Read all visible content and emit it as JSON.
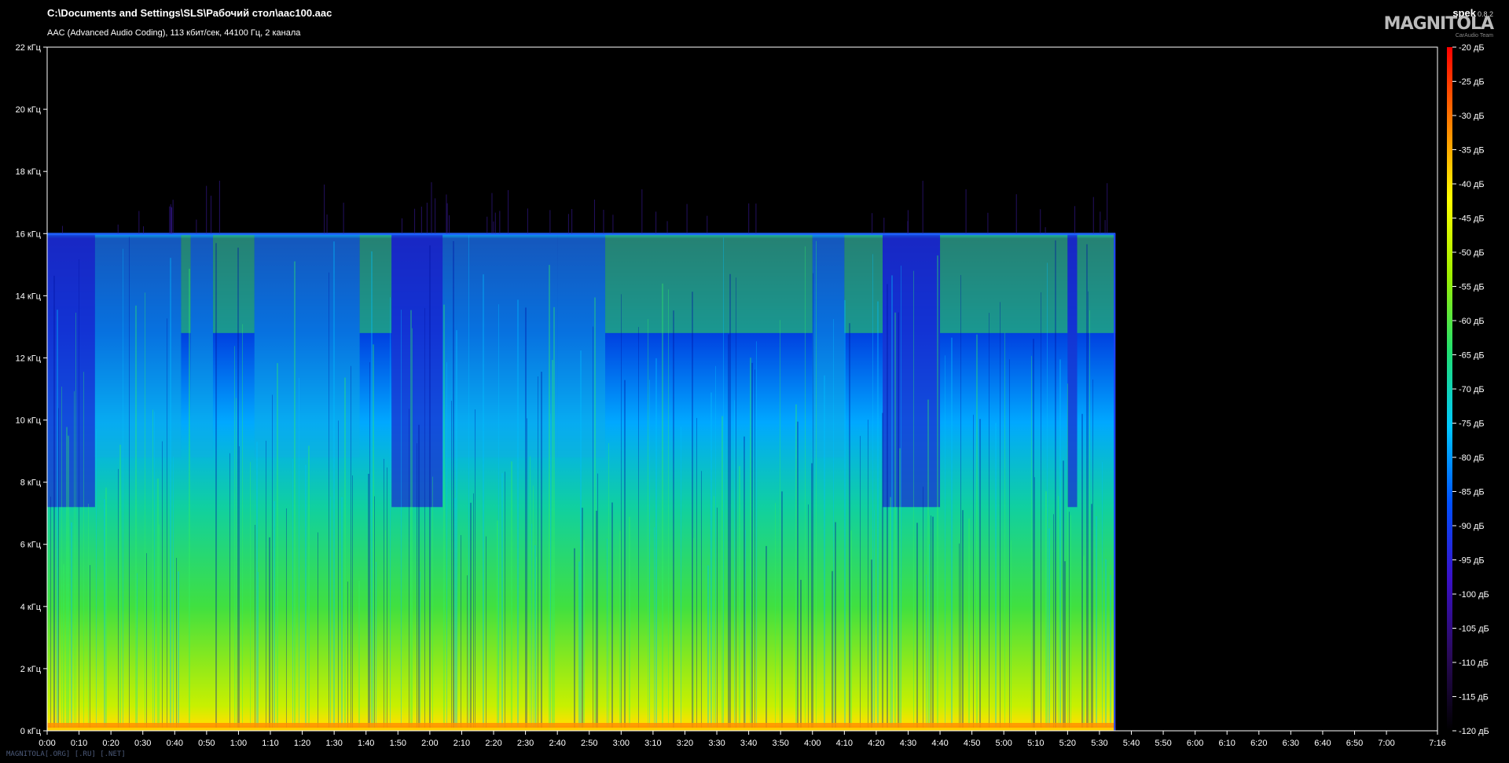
{
  "header": {
    "file_title": "C:\\Documents and Settings\\SLS\\Рабочий стол\\aac100.aac",
    "file_info": "AAC (Advanced Audio Coding), 113 кбит/сек, 44100 Гц, 2 канала",
    "app_name": "spek",
    "app_version": "0.8.2",
    "logo_text": "MAGNITOLA",
    "logo_subtext": "CarAudio Team"
  },
  "watermark": "MAGNITOLA[.ORG] [.RU] [.NET]",
  "chart_data": {
    "type": "heatmap",
    "title": "",
    "xlabel": "",
    "ylabel": "",
    "x_unit": "time (m:ss)",
    "y_unit": "kHz",
    "xlim_seconds": [
      0,
      436
    ],
    "ylim_khz": [
      0,
      22
    ],
    "audio_end_seconds": 335,
    "lowpass_cutoff_khz": 16,
    "x_ticks": [
      "0:00",
      "0:10",
      "0:20",
      "0:30",
      "0:40",
      "0:50",
      "1:00",
      "1:10",
      "1:20",
      "1:30",
      "1:40",
      "1:50",
      "2:00",
      "2:10",
      "2:20",
      "2:30",
      "2:40",
      "2:50",
      "3:00",
      "3:10",
      "3:20",
      "3:30",
      "3:40",
      "3:50",
      "4:00",
      "4:10",
      "4:20",
      "4:30",
      "4:40",
      "4:50",
      "5:00",
      "5:10",
      "5:20",
      "5:30",
      "5:40",
      "5:50",
      "6:00",
      "6:10",
      "6:20",
      "6:30",
      "6:40",
      "6:50",
      "7:00",
      "7:16"
    ],
    "y_ticks": [
      "0 кГц",
      "2 кГц",
      "4 кГц",
      "6 кГц",
      "8 кГц",
      "10 кГц",
      "12 кГц",
      "14 кГц",
      "16 кГц",
      "18 кГц",
      "20 кГц",
      "22 кГц"
    ],
    "colorbar_ticks": [
      "-20 дБ",
      "-25 дБ",
      "-30 дБ",
      "-35 дБ",
      "-40 дБ",
      "-45 дБ",
      "-50 дБ",
      "-55 дБ",
      "-60 дБ",
      "-65 дБ",
      "-70 дБ",
      "-75 дБ",
      "-80 дБ",
      "-85 дБ",
      "-90 дБ",
      "-95 дБ",
      "-100 дБ",
      "-105 дБ",
      "-110 дБ",
      "-115 дБ",
      "-120 дБ"
    ],
    "colorbar_range_db": [
      -120,
      -20
    ],
    "colorbar_colors": [
      "#000000",
      "#2a0a5a",
      "#3a10c8",
      "#0050ff",
      "#00c8ff",
      "#20e070",
      "#a0f000",
      "#ffff00",
      "#ff8000",
      "#ff0000"
    ],
    "loudness_profile": {
      "segments_seconds": [
        [
          0,
          15,
          "low"
        ],
        [
          15,
          42,
          "mid"
        ],
        [
          42,
          45,
          "high"
        ],
        [
          45,
          52,
          "mid"
        ],
        [
          52,
          65,
          "high"
        ],
        [
          65,
          98,
          "mid"
        ],
        [
          98,
          108,
          "high"
        ],
        [
          108,
          124,
          "low"
        ],
        [
          124,
          160,
          "mid"
        ],
        [
          160,
          175,
          "mid"
        ],
        [
          175,
          240,
          "high"
        ],
        [
          240,
          250,
          "mid"
        ],
        [
          250,
          262,
          "high"
        ],
        [
          262,
          280,
          "low"
        ],
        [
          280,
          320,
          "high"
        ],
        [
          320,
          323,
          "low"
        ],
        [
          323,
          335,
          "high"
        ]
      ]
    },
    "grid": false,
    "legend": "right"
  }
}
